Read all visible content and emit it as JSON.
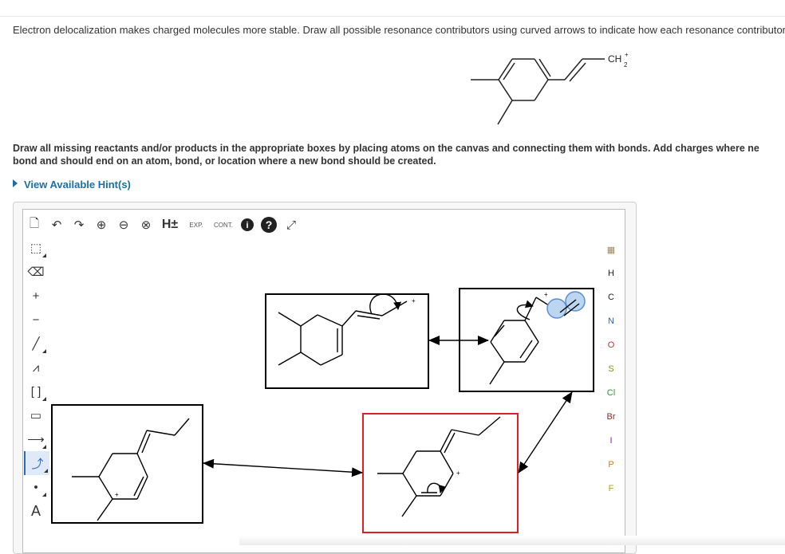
{
  "question": {
    "text": "Electron delocalization makes charged molecules more stable. Draw all possible resonance contributors using curved arrows to indicate how each resonance contributor",
    "molecule_label": "CH",
    "molecule_label_charge": "+",
    "molecule_label_subscript": "2"
  },
  "instructions": {
    "line1": "Draw all missing reactants and/or products in the appropriate boxes by placing atoms on the canvas and connecting them with bonds. Add charges where ne",
    "line2": "bond and should end on an atom, bond, or location where a new bond should be created."
  },
  "hint": {
    "label": "View Available Hint(s)"
  },
  "toolbar_top": {
    "items": [
      {
        "name": "new-document-icon",
        "glyph": "🗋"
      },
      {
        "name": "undo-icon",
        "glyph": "↶"
      },
      {
        "name": "redo-icon",
        "glyph": "↷"
      },
      {
        "name": "zoom-in-icon",
        "glyph": "⊕"
      },
      {
        "name": "zoom-out-icon",
        "glyph": "⊖"
      },
      {
        "name": "zoom-reset-icon",
        "glyph": "⊗"
      }
    ],
    "h_label": "H±",
    "exp_label": "EXP.",
    "cont_label": "CONT.",
    "info_glyph": "i",
    "help_glyph": "?",
    "expand_glyph": "⤢"
  },
  "toolbar_left": {
    "items": [
      {
        "name": "select-lasso-icon",
        "glyph": "⬚"
      },
      {
        "name": "eraser-icon",
        "glyph": "⌫"
      },
      {
        "name": "positive-charge-icon",
        "glyph": "+"
      },
      {
        "name": "negative-charge-icon",
        "glyph": "−"
      },
      {
        "name": "single-bond-icon",
        "glyph": "╱"
      },
      {
        "name": "chain-icon",
        "glyph": "⩘"
      },
      {
        "name": "bracket-icon",
        "glyph": "[ ]"
      },
      {
        "name": "rectangle-icon",
        "glyph": "▭"
      },
      {
        "name": "reaction-arrow-icon",
        "glyph": "⟶"
      },
      {
        "name": "curved-arrow-icon",
        "glyph": "⤴"
      },
      {
        "name": "radical-dot-icon",
        "glyph": "•"
      },
      {
        "name": "atom-label-icon",
        "glyph": "A"
      }
    ]
  },
  "toolbar_right": {
    "periodic_glyph": "▦",
    "elements": [
      {
        "symbol": "H",
        "color": "#333333"
      },
      {
        "symbol": "C",
        "color": "#333333"
      },
      {
        "symbol": "N",
        "color": "#2b5fc7"
      },
      {
        "symbol": "O",
        "color": "#d0302b"
      },
      {
        "symbol": "S",
        "color": "#9a8a1a"
      },
      {
        "symbol": "Cl",
        "color": "#2a9a2a"
      },
      {
        "symbol": "Br",
        "color": "#8a2a2a"
      },
      {
        "symbol": "I",
        "color": "#7a2a9a"
      },
      {
        "symbol": "P",
        "color": "#d07a1a"
      },
      {
        "symbol": "F",
        "color": "#b0a020"
      }
    ]
  },
  "canvas": {
    "charge_plus": "+",
    "highlight_color": "#e02020"
  }
}
